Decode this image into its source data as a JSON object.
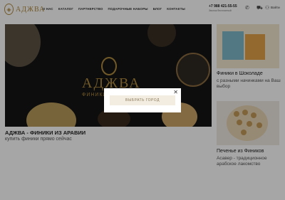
{
  "logo": {
    "text": "АДЖВА"
  },
  "nav": [
    "О НАС",
    "КАТАЛОГ",
    "ПАРТНЕРСТВО",
    "ПОДАРОЧНЫЕ НАБОРЫ",
    "БЛОГ",
    "КОНТАКТЫ"
  ],
  "header": {
    "phone": "+7 988 421-55-55",
    "phone_sub": "Звонок бесплатный",
    "signin": "Войти",
    "icons": [
      "phone-icon",
      "cart-icon",
      "user-icon"
    ]
  },
  "hero": {
    "brand": "АДЖВА",
    "brand_sub": "ФИНИКИ",
    "title": "АДЖВА - ФИНИКИ ИЗ АРАВИИ",
    "caption": "купить финики прямо сейчас"
  },
  "cards": [
    {
      "title": "Финики в Шоколаде",
      "caption": "с разными начинками на Ваш выбор"
    },
    {
      "title": "Печенье из Фиников",
      "caption": "Асавер - традиционное арабское лакомство"
    }
  ],
  "modal": {
    "button": "ВЫБРАТЬ ГОРОД",
    "close": "✕"
  }
}
